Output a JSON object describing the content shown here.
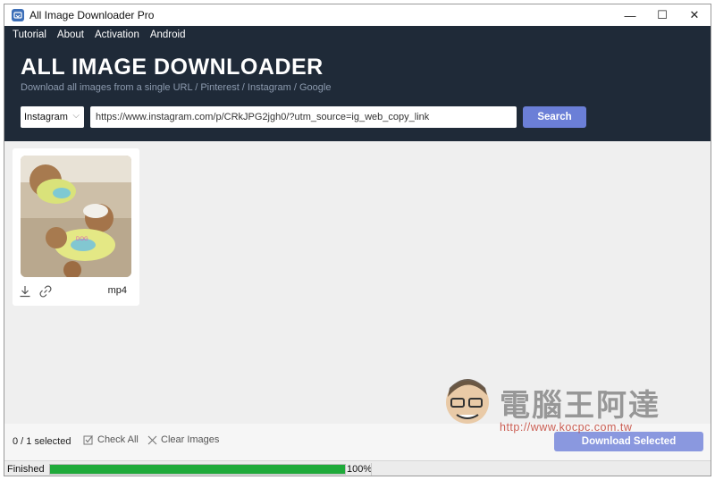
{
  "window": {
    "title": "All Image Downloader Pro",
    "controls": {
      "minimize": "—",
      "maximize": "☐",
      "close": "✕"
    }
  },
  "menu": [
    "Tutorial",
    "About",
    "Activation",
    "Android"
  ],
  "header": {
    "title": "ALL IMAGE DOWNLOADER",
    "subtitle": "Download all images from a single URL / Pinterest / Instagram / Google",
    "platform_selected": "Instagram",
    "url_value": "https://www.instagram.com/p/CRkJPG2jgh0/?utm_source=ig_web_copy_link",
    "search_label": "Search"
  },
  "results": [
    {
      "thumbnail_icon": "image-thumbnail",
      "type": "mp4"
    }
  ],
  "bottom": {
    "selected_count": "0 / 1 selected",
    "check_all": "Check All",
    "clear_images": "Clear Images",
    "download_selected": "Download Selected"
  },
  "watermark": {
    "text": "電腦王阿達",
    "url": "http://www.kocpc.com.tw"
  },
  "status": {
    "text": "Finished",
    "progress": 1.0,
    "progress_label": "100%"
  },
  "colors": {
    "header_bg": "#1f2a38",
    "accent": "#6b7fd7",
    "progress": "#1faa3a"
  }
}
